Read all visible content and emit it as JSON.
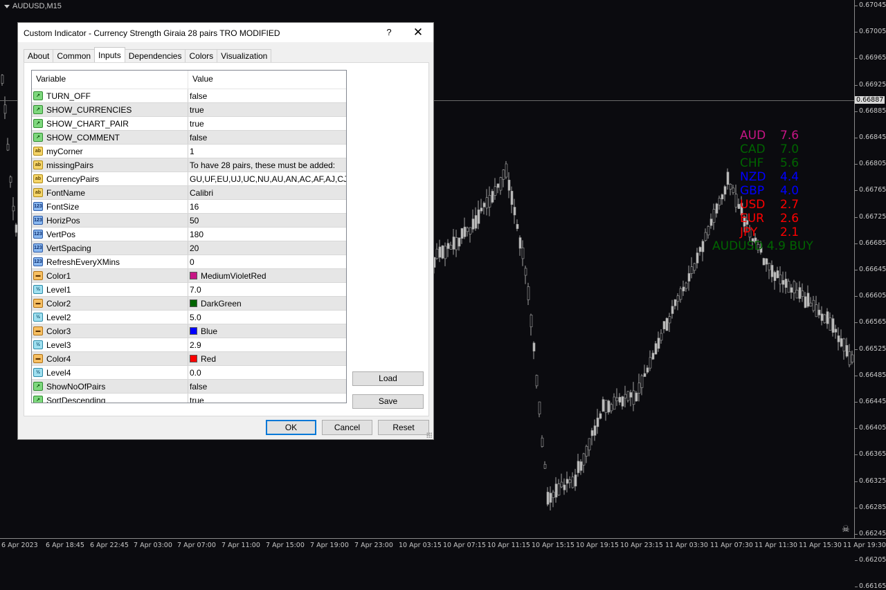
{
  "chart": {
    "symbol": "AUDUSD,M15",
    "current_price": "0.66887",
    "price_ticks": [
      "0.67045",
      "0.67005",
      "0.66965",
      "0.66925",
      "0.66885",
      "0.66845",
      "0.66805",
      "0.66765",
      "0.66725",
      "0.66685",
      "0.66645",
      "0.66605",
      "0.66565",
      "0.66525",
      "0.66485",
      "0.66445",
      "0.66405",
      "0.66365",
      "0.66325",
      "0.66285",
      "0.66245",
      "0.66205",
      "0.66165"
    ],
    "time_ticks": [
      "6 Apr 2023",
      "6 Apr 18:45",
      "6 Apr 22:45",
      "7 Apr 03:00",
      "7 Apr 07:00",
      "7 Apr 11:00",
      "7 Apr 15:00",
      "7 Apr 19:00",
      "7 Apr 23:00",
      "10 Apr 03:15",
      "10 Apr 07:15",
      "10 Apr 11:15",
      "10 Apr 15:15",
      "10 Apr 19:15",
      "10 Apr 23:15",
      "11 Apr 03:30",
      "11 Apr 07:30",
      "11 Apr 11:30",
      "11 Apr 15:30",
      "11 Apr 19:30"
    ],
    "strength": [
      {
        "cur": "AUD",
        "val": "7.6",
        "color": "#c71585"
      },
      {
        "cur": "CAD",
        "val": "7.0",
        "color": "#006400"
      },
      {
        "cur": "CHF",
        "val": "5.6",
        "color": "#006400"
      },
      {
        "cur": "NZD",
        "val": "4.4",
        "color": "#0000ff"
      },
      {
        "cur": "GBP",
        "val": "4.0",
        "color": "#0000ff"
      },
      {
        "cur": "USD",
        "val": "2.7",
        "color": "#ff0000"
      },
      {
        "cur": "EUR",
        "val": "2.6",
        "color": "#ff0000"
      },
      {
        "cur": "JPY",
        "val": "2.1",
        "color": "#ff0000"
      }
    ],
    "pair_line": {
      "text": "AUDUSD 4.9 BUY",
      "color": "#006400"
    }
  },
  "dialog": {
    "title": "Custom Indicator - Currency Strength Giraia 28 pairs TRO MODIFIED",
    "help": "?",
    "close": "✕",
    "tabs": [
      "About",
      "Common",
      "Inputs",
      "Dependencies",
      "Colors",
      "Visualization"
    ],
    "active_tab": "Inputs",
    "col_variable": "Variable",
    "col_value": "Value",
    "rows": [
      {
        "icon": "bool",
        "name": "TURN_OFF",
        "value": "false"
      },
      {
        "icon": "bool",
        "name": "SHOW_CURRENCIES",
        "value": "true"
      },
      {
        "icon": "bool",
        "name": "SHOW_CHART_PAIR",
        "value": "true"
      },
      {
        "icon": "bool",
        "name": "SHOW_COMMENT",
        "value": "false"
      },
      {
        "icon": "str",
        "name": "myCorner",
        "value": "1"
      },
      {
        "icon": "str",
        "name": "missingPairs",
        "value": "To have 28 pairs, these must be added:"
      },
      {
        "icon": "str",
        "name": "CurrencyPairs",
        "value": "GU,UF,EU,UJ,UC,NU,AU,AN,AC,AF,AJ,CJ,..."
      },
      {
        "icon": "str",
        "name": "FontName",
        "value": "Calibri"
      },
      {
        "icon": "int",
        "name": "FontSize",
        "value": "16"
      },
      {
        "icon": "int",
        "name": "HorizPos",
        "value": "50"
      },
      {
        "icon": "int",
        "name": "VertPos",
        "value": "180"
      },
      {
        "icon": "int",
        "name": "VertSpacing",
        "value": "20"
      },
      {
        "icon": "int",
        "name": "RefreshEveryXMins",
        "value": "0"
      },
      {
        "icon": "col",
        "name": "Color1",
        "value": "MediumVioletRed",
        "swatch": "#c71585"
      },
      {
        "icon": "dbl",
        "name": "Level1",
        "value": "7.0"
      },
      {
        "icon": "col",
        "name": "Color2",
        "value": "DarkGreen",
        "swatch": "#006400"
      },
      {
        "icon": "dbl",
        "name": "Level2",
        "value": "5.0"
      },
      {
        "icon": "col",
        "name": "Color3",
        "value": "Blue",
        "swatch": "#0000ff"
      },
      {
        "icon": "dbl",
        "name": "Level3",
        "value": "2.9"
      },
      {
        "icon": "col",
        "name": "Color4",
        "value": "Red",
        "swatch": "#ff0000"
      },
      {
        "icon": "dbl",
        "name": "Level4",
        "value": "0.0"
      },
      {
        "icon": "bool",
        "name": "ShowNoOfPairs",
        "value": "false"
      },
      {
        "icon": "bool",
        "name": "SortDescending",
        "value": "true"
      }
    ],
    "icon_glyphs": {
      "bool": "↗",
      "str": "ab",
      "int": "123",
      "col": "▬",
      "dbl": "½"
    },
    "load": "Load",
    "save": "Save",
    "ok": "OK",
    "cancel": "Cancel",
    "reset": "Reset"
  }
}
